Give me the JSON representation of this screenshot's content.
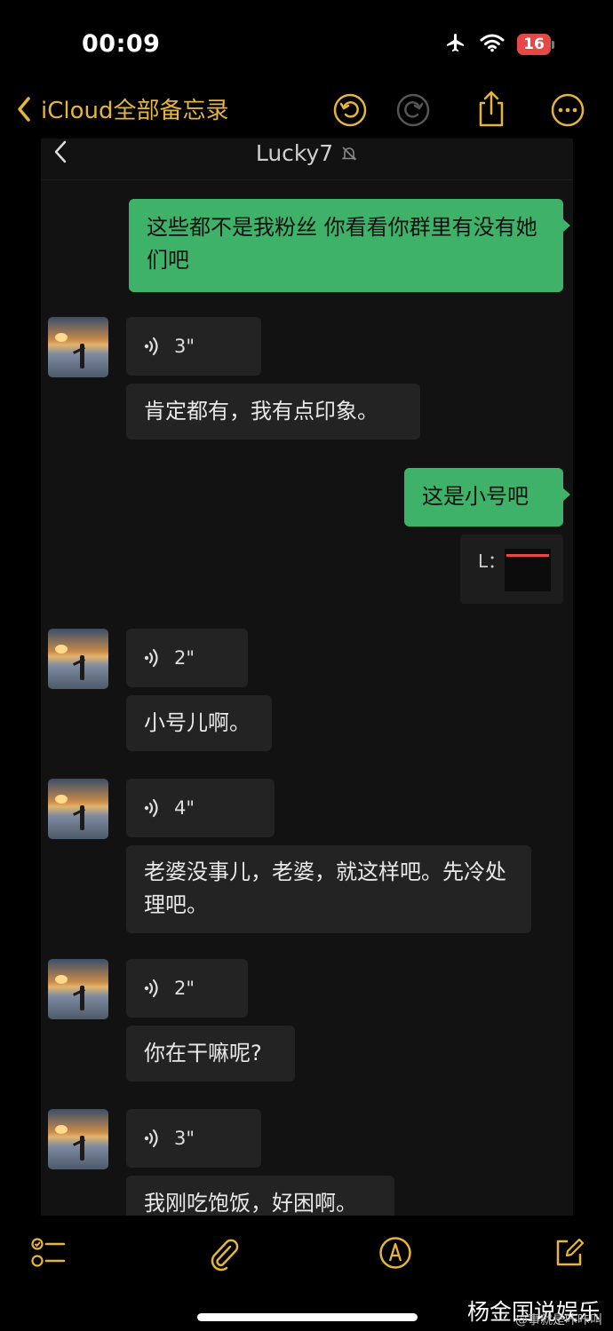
{
  "status_bar": {
    "time": "00:09",
    "battery": "16"
  },
  "nav": {
    "back_label": "iCloud全部备忘录"
  },
  "chat": {
    "title": "Lucky7",
    "messages": [
      {
        "dir": "out",
        "type": "text",
        "text": "这些都不是我粉丝 你看看你群里有没有她们吧"
      },
      {
        "dir": "in",
        "type": "voice",
        "duration": "3\""
      },
      {
        "dir": "in",
        "type": "text",
        "text": "肯定都有，我有点印象。"
      },
      {
        "dir": "out",
        "type": "text",
        "text": "这是小号吧"
      },
      {
        "dir": "out",
        "type": "image",
        "label": "L："
      },
      {
        "dir": "in",
        "type": "voice",
        "duration": "2\""
      },
      {
        "dir": "in",
        "type": "text",
        "text": "小号儿啊。"
      },
      {
        "dir": "in",
        "type": "voice",
        "duration": "4\""
      },
      {
        "dir": "in",
        "type": "text",
        "text": "老婆没事儿，老婆，就这样吧。先冷处理吧。"
      },
      {
        "dir": "in",
        "type": "voice",
        "duration": "2\""
      },
      {
        "dir": "in",
        "type": "text",
        "text": "你在干嘛呢?"
      },
      {
        "dir": "in",
        "type": "voice",
        "duration": "3\""
      },
      {
        "dir": "in",
        "type": "text",
        "text": "我刚吃饱饭，好困啊。"
      }
    ]
  },
  "watermark": {
    "main": "杨金国说娱乐",
    "sub": "@事就是咔咔叫"
  },
  "colors": {
    "accent": "#e5b53c",
    "bubble_out": "#3fb26a",
    "bubble_in": "#232323",
    "battery": "#e64848"
  }
}
